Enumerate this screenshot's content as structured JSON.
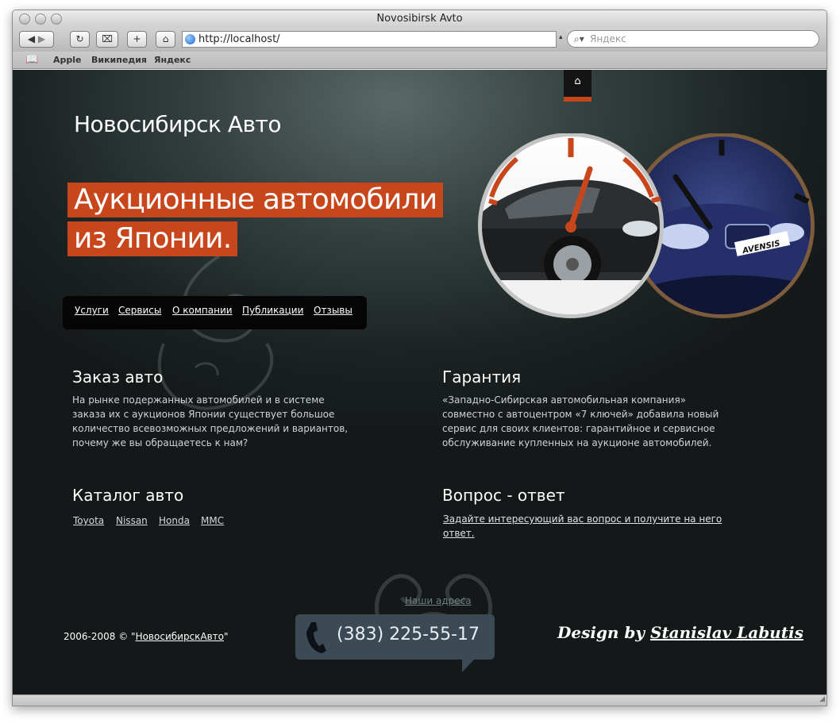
{
  "browser": {
    "title": "Novosibirsk Avto",
    "url": "http://localhost/",
    "search_placeholder": "Яндекс",
    "bookmarks": [
      "Apple",
      "Википедия",
      "Яндекс"
    ]
  },
  "site": {
    "title": "Новосибирск Авто",
    "hero_line1": "Аукционные автомобили",
    "hero_line2": "из Японии.",
    "nav": [
      "Услуги",
      "Сервисы",
      "О компании",
      "Публикации",
      "Отзывы"
    ],
    "accent_color": "#c8461b"
  },
  "blocks": {
    "order": {
      "title": "Заказ авто",
      "lines": [
        "На рынке подержанных автомобилей и в системе",
        "заказа их с аукционов Японии существует большое",
        "количество всевозможных предложений и вариантов,",
        "почему же вы обращаетесь к нам?"
      ]
    },
    "warranty": {
      "title": "Гарантия",
      "lines": [
        "«Западно-Сибирская автомобильная компания»",
        "совместно с автоцентром «7 ключей» добавила новый",
        "сервис для своих клиентов: гарантийное и сервисное",
        "обслуживание купленных на аукционе автомобилей."
      ]
    },
    "catalog": {
      "title": "Каталог авто",
      "brands": [
        "Toyota",
        "Nissan",
        "Honda",
        "MMC"
      ]
    },
    "faq": {
      "title": "Вопрос - ответ",
      "link_line1": "Задайте интересующий вас вопрос и получите на него",
      "link_line2": "ответ."
    }
  },
  "footer": {
    "copy_prefix": "2006-2008 © \"",
    "copy_link": "НовосибирскАвто",
    "copy_suffix": "\"",
    "addresses_link": "Наши адреса",
    "phone": "(383) 225-55-17",
    "design_prefix": "Design by",
    "design_name": "Stanislav Labutis"
  },
  "car_badge": "AVENSIS"
}
